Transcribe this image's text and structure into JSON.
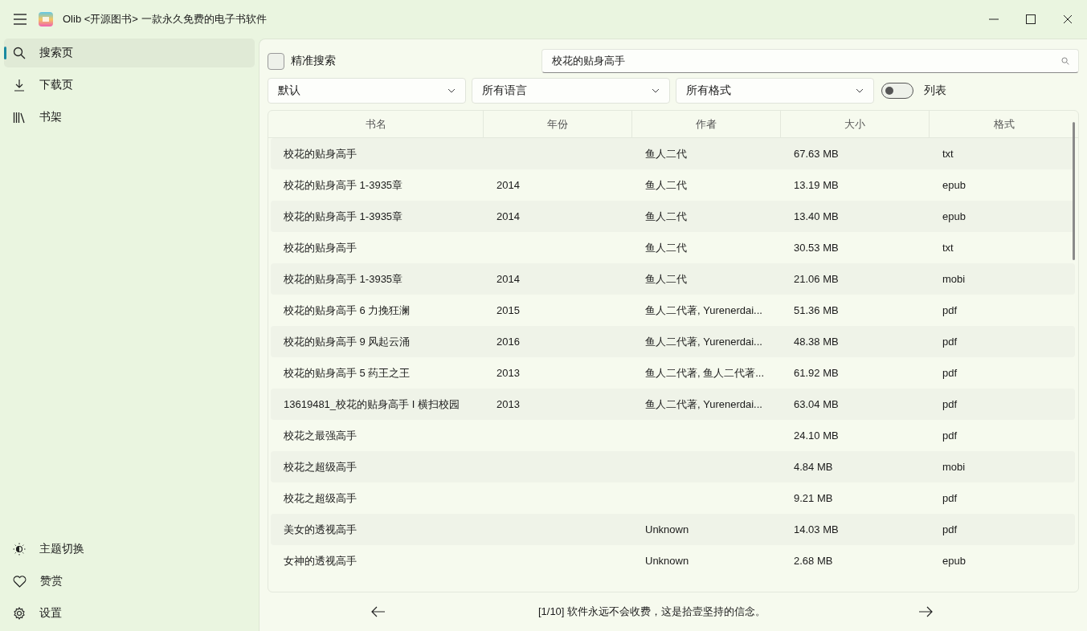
{
  "window": {
    "title": "Olib <开源图书> 一款永久免费的电子书软件"
  },
  "sidebar": {
    "items": [
      {
        "label": "搜索页",
        "selected": true
      },
      {
        "label": "下载页",
        "selected": false
      },
      {
        "label": "书架",
        "selected": false
      }
    ],
    "bottom_items": [
      {
        "label": "主题切换"
      },
      {
        "label": "赞赏"
      },
      {
        "label": "设置"
      }
    ]
  },
  "search": {
    "exact_label": "精准搜索",
    "exact_checked": false,
    "value": "校花的贴身高手"
  },
  "filters": [
    {
      "value": "默认"
    },
    {
      "value": "所有语言"
    },
    {
      "value": "所有格式"
    }
  ],
  "list_toggle": {
    "label": "列表",
    "on": false
  },
  "table": {
    "columns": [
      "书名",
      "年份",
      "作者",
      "大小",
      "格式"
    ],
    "rows": [
      [
        "校花的贴身高手",
        "",
        "鱼人二代",
        "67.63 MB",
        "txt"
      ],
      [
        "校花的贴身高手 1-3935章",
        "2014",
        "鱼人二代",
        "13.19 MB",
        "epub"
      ],
      [
        "校花的贴身高手 1-3935章",
        "2014",
        "鱼人二代",
        "13.40 MB",
        "epub"
      ],
      [
        "校花的贴身高手",
        "",
        "鱼人二代",
        "30.53 MB",
        "txt"
      ],
      [
        "校花的贴身高手 1-3935章",
        "2014",
        "鱼人二代",
        "21.06 MB",
        "mobi"
      ],
      [
        "校花的贴身高手 6 力挽狂澜",
        "2015",
        "鱼人二代著, Yurenerdai...",
        "51.36 MB",
        "pdf"
      ],
      [
        "校花的贴身高手 9 风起云涌",
        "2016",
        "鱼人二代著, Yurenerdai...",
        "48.38 MB",
        "pdf"
      ],
      [
        "校花的贴身高手 5 药王之王",
        "2013",
        "鱼人二代著, 鱼人二代著...",
        "61.92 MB",
        "pdf"
      ],
      [
        "13619481_校花的贴身高手 I 横扫校园",
        "2013",
        "鱼人二代著, Yurenerdai...",
        "63.04 MB",
        "pdf"
      ],
      [
        "校花之最强高手",
        "",
        "",
        "24.10 MB",
        "pdf"
      ],
      [
        "校花之超级高手",
        "",
        "",
        "4.84 MB",
        "mobi"
      ],
      [
        "校花之超级高手",
        "",
        "",
        "9.21 MB",
        "pdf"
      ],
      [
        "美女的透视高手",
        "",
        "Unknown",
        "14.03 MB",
        "pdf"
      ],
      [
        "女神的透视高手",
        "",
        "Unknown",
        "2.68 MB",
        "epub"
      ]
    ]
  },
  "footer": {
    "text": "[1/10] 软件永远不会收费，这是拾壹坚持的信念。"
  }
}
